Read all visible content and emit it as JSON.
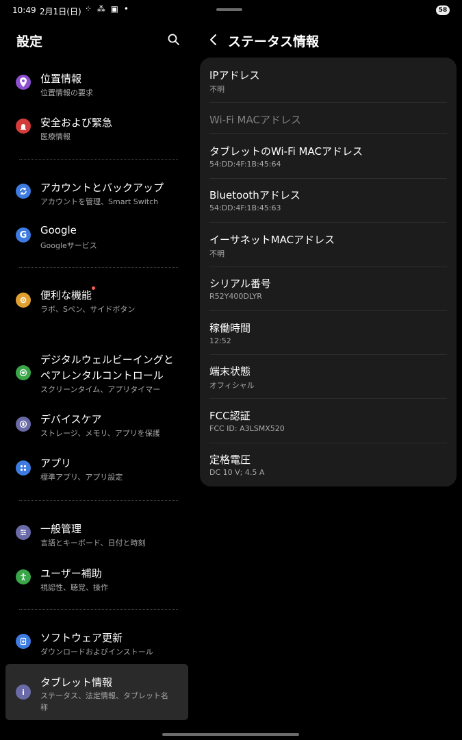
{
  "status_bar": {
    "time": "10:49",
    "date": "2月1日(日)",
    "icons": "⁘ ⁂ ▣ •",
    "battery": "58"
  },
  "left_panel": {
    "title": "設定",
    "items": [
      {
        "title": "位置情報",
        "subtitle": "位置情報の要求",
        "icon": "location-pin-icon",
        "color": "#8b4fd0"
      },
      {
        "title": "安全および緊急",
        "subtitle": "医療情報",
        "icon": "siren-icon",
        "color": "#d43b3b"
      },
      {
        "title": "アカウントとバックアップ",
        "subtitle": "アカウントを管理、Smart Switch",
        "icon": "sync-icon",
        "color": "#3e7be0"
      },
      {
        "title": "Google",
        "subtitle": "Googleサービス",
        "icon": "google-icon",
        "color": "#3e7be0"
      },
      {
        "title": "便利な機能",
        "subtitle": "ラボ、Sペン、サイドボタン",
        "icon": "star-gear-icon",
        "color": "#e0a030"
      },
      {
        "title": "デジタルウェルビーイングと",
        "title2": "ペアレンタルコントロール",
        "subtitle": "スクリーンタイム、アプリタイマー",
        "icon": "heart-circle-icon",
        "color": "#3aa64a"
      },
      {
        "title": "デバイスケア",
        "subtitle": "ストレージ、メモリ、アプリを保護",
        "icon": "device-care-icon",
        "color": "#6a6aa8"
      },
      {
        "title": "アプリ",
        "subtitle": "標準アプリ、アプリ設定",
        "icon": "apps-grid-icon",
        "color": "#3e7be0"
      },
      {
        "title": "一般管理",
        "subtitle": "言語とキーボード、日付と時刻",
        "icon": "sliders-icon",
        "color": "#6a6aa8"
      },
      {
        "title": "ユーザー補助",
        "subtitle": "視認性、聴覚、操作",
        "icon": "accessibility-icon",
        "color": "#3aa64a"
      },
      {
        "title": "ソフトウェア更新",
        "subtitle": "ダウンロードおよびインストール",
        "icon": "software-update-icon",
        "color": "#3e7be0"
      },
      {
        "title": "タブレット情報",
        "subtitle": "ステータス、法定情報、タブレット名",
        "subtitle2": "称",
        "icon": "info-icon",
        "color": "#6a6aa8"
      }
    ]
  },
  "right_panel": {
    "title": "ステータス情報",
    "rows": [
      {
        "label": "IPアドレス",
        "value": "不明"
      },
      {
        "label": "Wi-Fi MACアドレス",
        "value": ""
      },
      {
        "label": "タブレットのWi-Fi MACアドレス",
        "value": "54:DD:4F:1B:45:64"
      },
      {
        "label": "Bluetoothアドレス",
        "value": "54:DD:4F:1B:45:63"
      },
      {
        "label": "イーサネットMACアドレス",
        "value": "不明"
      },
      {
        "label": "シリアル番号",
        "value": "R52Y400DLYR"
      },
      {
        "label": "稼働時間",
        "value": "12:52"
      },
      {
        "label": "端末状態",
        "value": "オフィシャル"
      },
      {
        "label": "FCC認証",
        "value": "FCC ID: A3LSMX520"
      },
      {
        "label": "定格電圧",
        "value": "DC 10 V; 4.5 A"
      }
    ]
  }
}
